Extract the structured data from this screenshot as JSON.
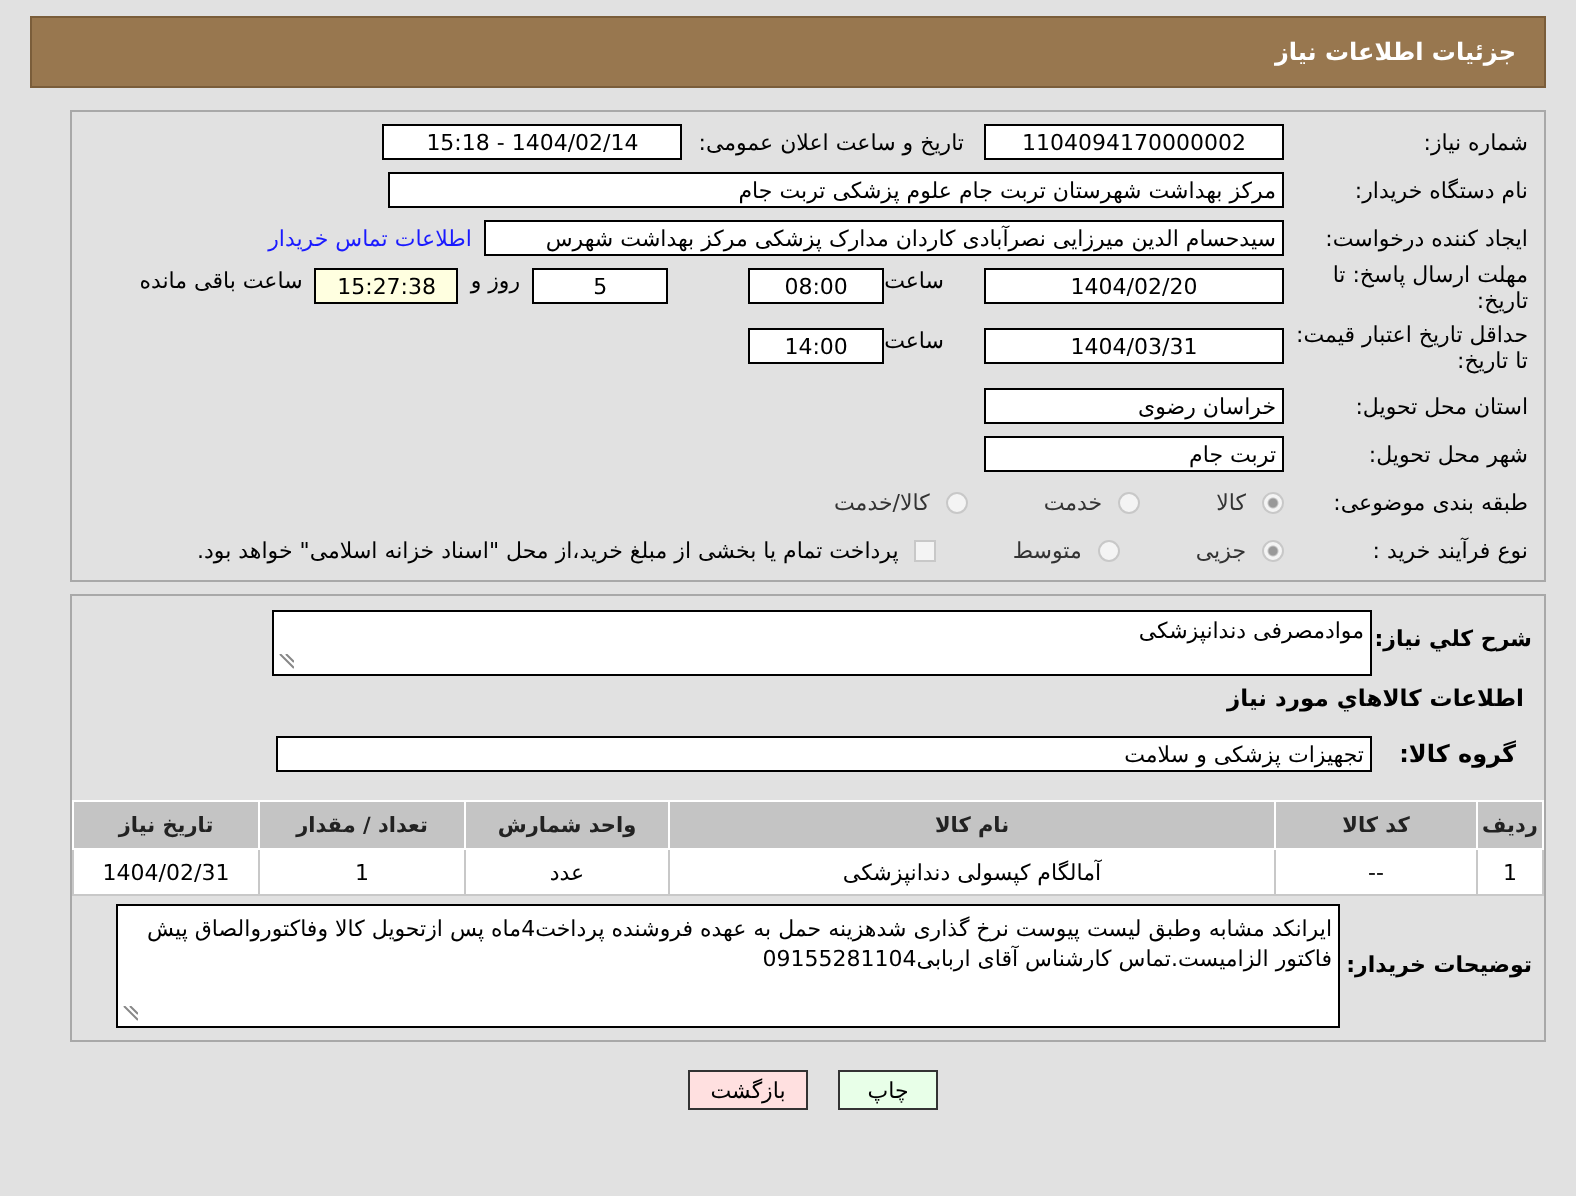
{
  "header": {
    "title": "جزئیات اطلاعات نیاز"
  },
  "need_number": {
    "label": "شماره نیاز:",
    "value": "1104094170000002"
  },
  "announce": {
    "label": "تاریخ و ساعت اعلان عمومی:",
    "value": "1404/02/14 - 15:18"
  },
  "buyer_org": {
    "label": "نام دستگاه خریدار:",
    "value": "مرکز بهداشت شهرستان تربت جام  علوم پزشکی تربت جام"
  },
  "requester": {
    "label": "ایجاد کننده درخواست:",
    "value": "سیدحسام الدین میرزایی نصرآبادی کاردان مدارک پزشکی مرکز بهداشت شهرس",
    "link": "اطلاعات تماس خریدار"
  },
  "deadline": {
    "label": "مهلت ارسال پاسخ: تا تاریخ:",
    "date": "1404/02/20",
    "time_label": "ساعت",
    "time": "08:00",
    "days": "5",
    "days_label": "روز و",
    "remaining": "15:27:38",
    "remaining_label": "ساعت باقی مانده"
  },
  "validity": {
    "label": "حداقل تاریخ اعتبار قیمت: تا تاریخ:",
    "date": "1404/03/31",
    "time_label": "ساعت",
    "time": "14:00"
  },
  "province": {
    "label": "استان محل تحویل:",
    "value": "خراسان رضوی"
  },
  "city": {
    "label": "شهر محل تحویل:",
    "value": "تربت جام"
  },
  "category": {
    "label": "طبقه بندی موضوعی:",
    "options": [
      {
        "label": "کالا",
        "selected": true
      },
      {
        "label": "خدمت",
        "selected": false
      },
      {
        "label": "کالا/خدمت",
        "selected": false
      }
    ]
  },
  "process": {
    "label": "نوع فرآیند خرید :",
    "options": [
      {
        "label": "جزیی",
        "selected": true
      },
      {
        "label": "متوسط",
        "selected": false
      }
    ],
    "payment": {
      "label": "پرداخت تمام یا بخشی از مبلغ خرید،از محل \"اسناد خزانه اسلامی\" خواهد بود.",
      "checked": false
    }
  },
  "description": {
    "label": "شرح کلي نياز:",
    "value": "موادمصرفی دندانپزشکی"
  },
  "goods_heading": "اطلاعات كالاهاي مورد نياز",
  "goods_group": {
    "label": "گروه کالا:",
    "value": "تجهیزات پزشکی و سلامت"
  },
  "table": {
    "columns": [
      "ردیف",
      "کد کالا",
      "نام کالا",
      "واحد شمارش",
      "تعداد / مقدار",
      "تاریخ نیاز"
    ],
    "rows": [
      [
        "1",
        "--",
        "آمالگام کپسولی دندانپزشکی",
        "عدد",
        "1",
        "1404/02/31"
      ]
    ]
  },
  "buyer_notes": {
    "label": "توضیحات خریدار:",
    "value": "ایرانکد مشابه وطبق لیست پیوست نرخ گذاری شدهزینه حمل به عهده فروشنده پرداخت4ماه پس ازتحویل کالا وفاکتوروالصاق پیش فاکتور الزامیست.تماس کارشناس آقای اربابی09155281104"
  },
  "buttons": [
    {
      "label": "چاپ",
      "kind": "print"
    },
    {
      "label": "بازگشت",
      "kind": "back"
    }
  ]
}
